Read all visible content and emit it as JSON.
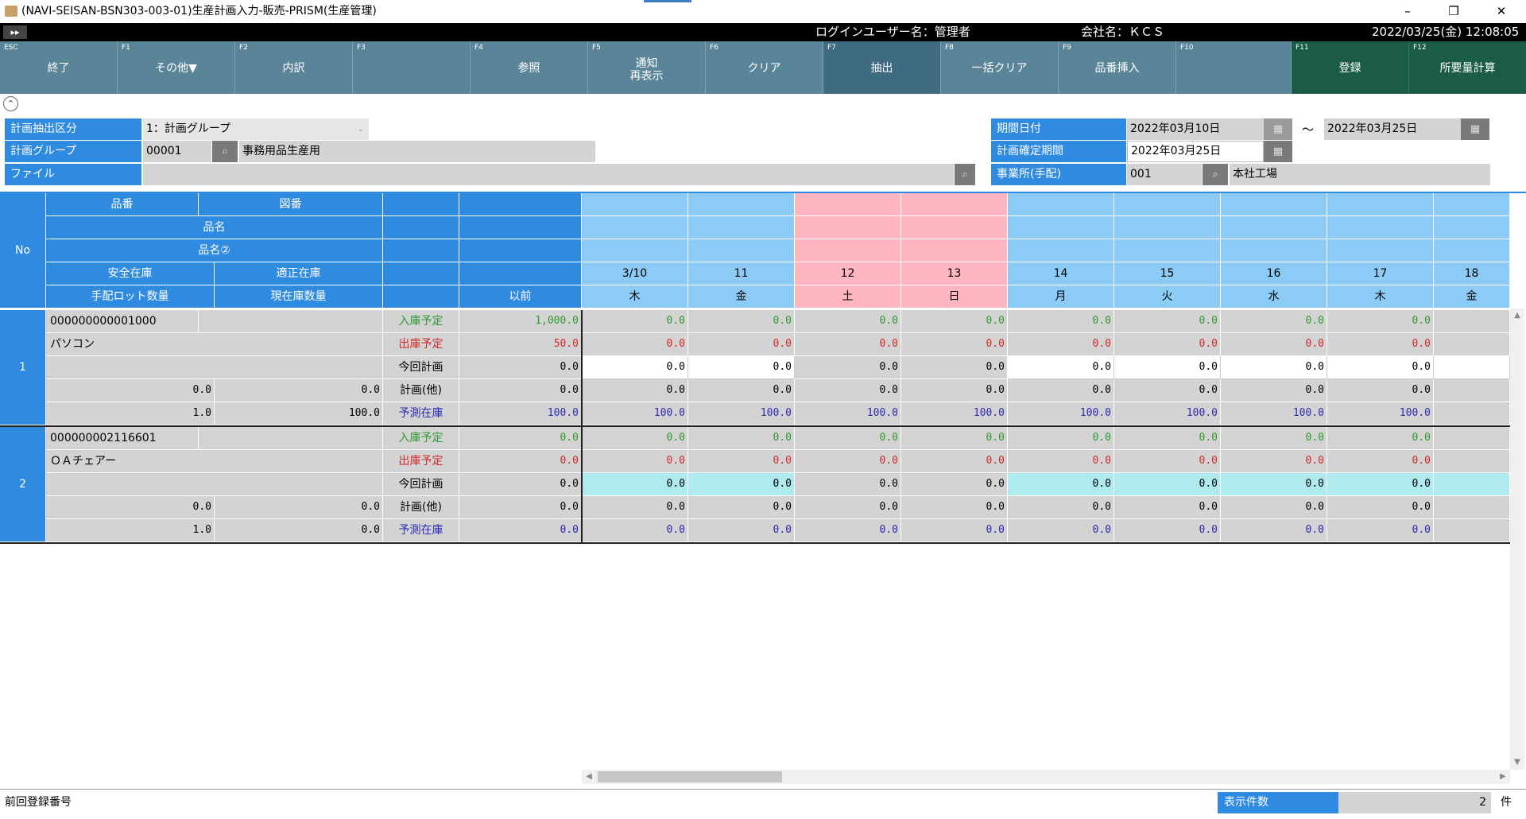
{
  "window": {
    "title": "(NAVI-SEISAN-BSN303-003-01)生産計画入力-販売-PRISM(生産管理)",
    "minimize": "–",
    "restore": "❐",
    "close": "✕"
  },
  "infobar": {
    "expand": "▸▸",
    "login_user": "ログインユーザー名：管理者",
    "company": "会社名：ＫＣＳ",
    "datetime": "2022/03/25(金) 12:08:05"
  },
  "fkeys": [
    {
      "code": "ESC",
      "label": "終了"
    },
    {
      "code": "F1",
      "label": "その他▼"
    },
    {
      "code": "F2",
      "label": "内訳"
    },
    {
      "code": "F3",
      "label": ""
    },
    {
      "code": "F4",
      "label": "参照"
    },
    {
      "code": "F5",
      "label": "通知\n再表示"
    },
    {
      "code": "F6",
      "label": "クリア"
    },
    {
      "code": "F7",
      "label": "抽出"
    },
    {
      "code": "F8",
      "label": "一括クリア"
    },
    {
      "code": "F9",
      "label": "品番挿入"
    },
    {
      "code": "F10",
      "label": ""
    },
    {
      "code": "F11",
      "label": "登録"
    },
    {
      "code": "F12",
      "label": "所要量計算"
    }
  ],
  "collapse_icon": "⌃",
  "form": {
    "extract_label": "計画抽出区分",
    "extract_value": "1：計画グループ",
    "group_label": "計画グループ",
    "group_code": "00001",
    "group_name": "事務用品生産用",
    "file_label": "ファイル",
    "file_value": "",
    "period_label": "期間日付",
    "period_from": "2022年03月10日",
    "period_tilde": "～",
    "period_to": "2022年03月25日",
    "confirm_label": "計画確定期間",
    "confirm_value": "2022年03月25日",
    "office_label": "事業所(手配)",
    "office_code": "001",
    "office_name": "本社工場"
  },
  "grid_header": {
    "no": "No",
    "item_code": "品番",
    "drawing_no": "図番",
    "item_name": "品名",
    "item_name2": "品名②",
    "safety_stock": "安全在庫",
    "proper_stock": "適正在庫",
    "lot_qty": "手配ロット数量",
    "current_stock": "現在庫数量",
    "before": "以前",
    "dates": [
      "3/10",
      "11",
      "12",
      "13",
      "14",
      "15",
      "16",
      "17",
      "18"
    ],
    "weekdays": [
      "木",
      "金",
      "土",
      "日",
      "月",
      "火",
      "水",
      "木",
      "金"
    ]
  },
  "row_labels": [
    "入庫予定",
    "出庫予定",
    "今回計画",
    "計画(他)",
    "予測在庫"
  ],
  "items": [
    {
      "no": "1",
      "code": "000000000001000",
      "name": "パソコン",
      "safety": "0.0",
      "proper": "0.0",
      "lot": "1.0",
      "current": "100.0",
      "before": [
        "1,000.0",
        "50.0",
        "0.0",
        "0.0",
        "100.0"
      ],
      "days": [
        [
          "0.0",
          "0.0",
          "0.0",
          "0.0",
          "0.0",
          "0.0",
          "0.0",
          "0.0",
          ""
        ],
        [
          "0.0",
          "0.0",
          "0.0",
          "0.0",
          "0.0",
          "0.0",
          "0.0",
          "0.0",
          ""
        ],
        [
          "0.0",
          "0.0",
          "0.0",
          "0.0",
          "0.0",
          "0.0",
          "0.0",
          "0.0",
          ""
        ],
        [
          "0.0",
          "0.0",
          "0.0",
          "0.0",
          "0.0",
          "0.0",
          "0.0",
          "0.0",
          ""
        ],
        [
          "100.0",
          "100.0",
          "100.0",
          "100.0",
          "100.0",
          "100.0",
          "100.0",
          "100.0",
          ""
        ]
      ]
    },
    {
      "no": "2",
      "code": "000000002116601",
      "name": "ＯＡチェアー",
      "safety": "0.0",
      "proper": "0.0",
      "lot": "1.0",
      "current": "0.0",
      "before": [
        "0.0",
        "0.0",
        "0.0",
        "0.0",
        "0.0"
      ],
      "days": [
        [
          "0.0",
          "0.0",
          "0.0",
          "0.0",
          "0.0",
          "0.0",
          "0.0",
          "0.0",
          ""
        ],
        [
          "0.0",
          "0.0",
          "0.0",
          "0.0",
          "0.0",
          "0.0",
          "0.0",
          "0.0",
          ""
        ],
        [
          "0.0",
          "0.0",
          "0.0",
          "0.0",
          "0.0",
          "0.0",
          "0.0",
          "0.0",
          ""
        ],
        [
          "0.0",
          "0.0",
          "0.0",
          "0.0",
          "0.0",
          "0.0",
          "0.0",
          "0.0",
          ""
        ],
        [
          "0.0",
          "0.0",
          "0.0",
          "0.0",
          "0.0",
          "0.0",
          "0.0",
          "0.0",
          ""
        ]
      ]
    }
  ],
  "footer": {
    "last_reg_label": "前回登録番号",
    "count_label": "表示件数",
    "count_value": "2",
    "count_unit": "件"
  },
  "scroll": {
    "up": "▲",
    "down": "▼",
    "left": "◀",
    "right": "▶"
  },
  "colors": {
    "header_blue": "#2f8be0",
    "light_blue": "#8ccbf5",
    "pink": "#ffb6c1",
    "fkey": "#5a8599",
    "fkey_green": "#1b5c47",
    "cyan": "#aeeaee"
  }
}
